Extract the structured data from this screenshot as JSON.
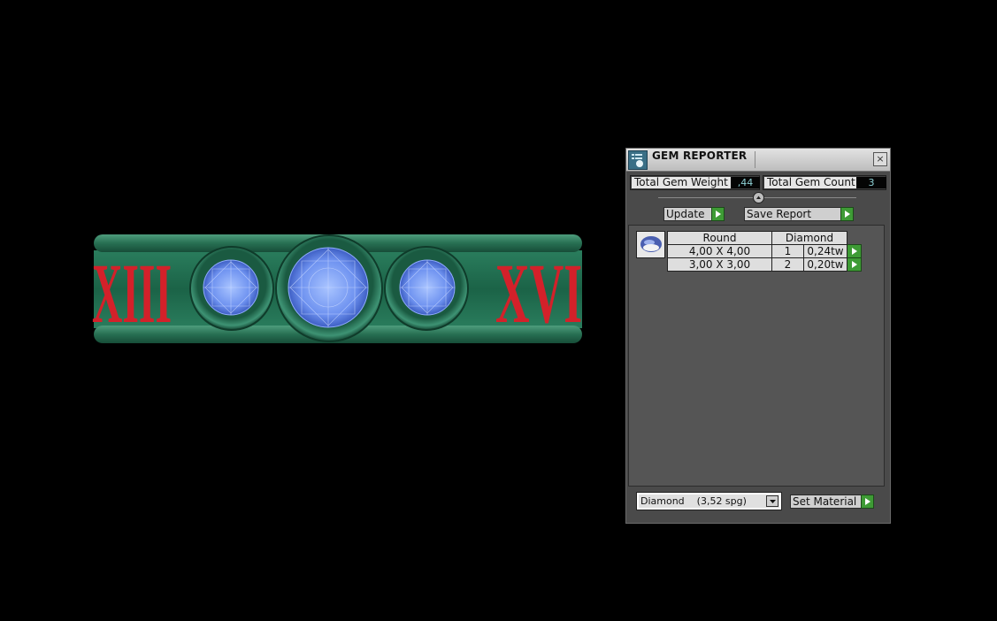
{
  "window": {
    "title": "GEM REPORTER",
    "close_glyph": "×"
  },
  "stats": {
    "weight_label": "Total Gem Weight",
    "weight_value": ",44",
    "count_label": "Total Gem Count",
    "count_value": "3"
  },
  "buttons": {
    "update_label": "Update",
    "save_report_label": "Save Report",
    "set_material_label": "Set Material"
  },
  "gem_table": {
    "headers": [
      "Round",
      "Diamond"
    ],
    "rows": [
      {
        "size": "4,00 X 4,00",
        "count": "1",
        "weight": "0,24tw"
      },
      {
        "size": "3,00 X 3,00",
        "count": "2",
        "weight": "0,20tw"
      }
    ]
  },
  "material_select": {
    "value": "Diamond    (3,52 spg)"
  },
  "viewport": {
    "numerals_left": "XIII",
    "numerals_right": "XVI"
  },
  "colors": {
    "band": "#1f6d4f",
    "numerals": "#d3212a",
    "gems": "#6a8fe8",
    "button_go": "#3e9b35",
    "value_text": "#8ed1d5"
  }
}
